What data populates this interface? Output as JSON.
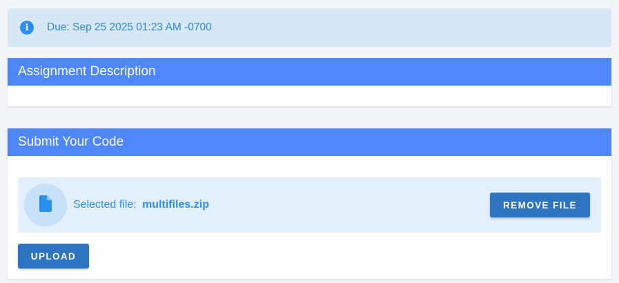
{
  "due": {
    "icon": "info-icon",
    "text": "Due: Sep 25 2025 01:23 AM -0700"
  },
  "description": {
    "title": "Assignment Description"
  },
  "submit": {
    "title": "Submit Your Code",
    "file": {
      "icon": "file-icon",
      "label": "Selected file:",
      "name": "multifiles.zip"
    },
    "remove_label": "REMOVE FILE",
    "upload_label": "UPLOAD"
  },
  "colors": {
    "header": "#4e86fc",
    "button": "#2f74c0",
    "accent_text": "#2a8ff0",
    "banner": "#d8e7f6",
    "file_panel": "#e3f0fc"
  }
}
